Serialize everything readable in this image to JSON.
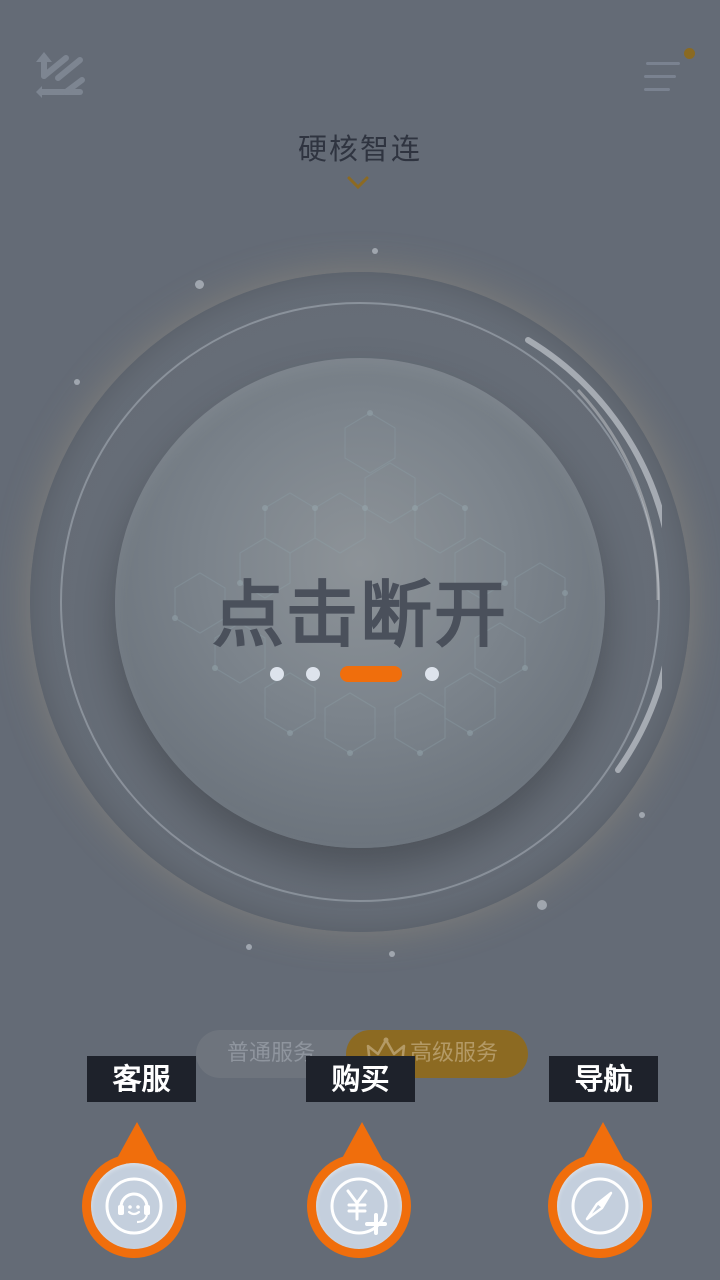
{
  "header": {
    "switch_icon": "switch-arrows-icon",
    "menu_icon": "menu-icon",
    "line_name": "硬核智连",
    "expand_icon": "chevron-down-icon"
  },
  "connect_button": {
    "label": "点击断开",
    "page_count": 4,
    "active_page": 3
  },
  "service_toggle": {
    "normal_label": "普通服务",
    "premium_label": "高级服务",
    "premium_icon": "crown-icon",
    "selected": "premium"
  },
  "actions": [
    {
      "label": "客服",
      "icon": "headset-icon"
    },
    {
      "label": "购买",
      "icon": "yuan-plus-icon"
    },
    {
      "label": "导航",
      "icon": "compass-icon"
    }
  ],
  "colors": {
    "background": "#646b76",
    "accent": "#f06e0c",
    "premium_gold": "#8c6a22",
    "label_bg": "#1e222b"
  }
}
